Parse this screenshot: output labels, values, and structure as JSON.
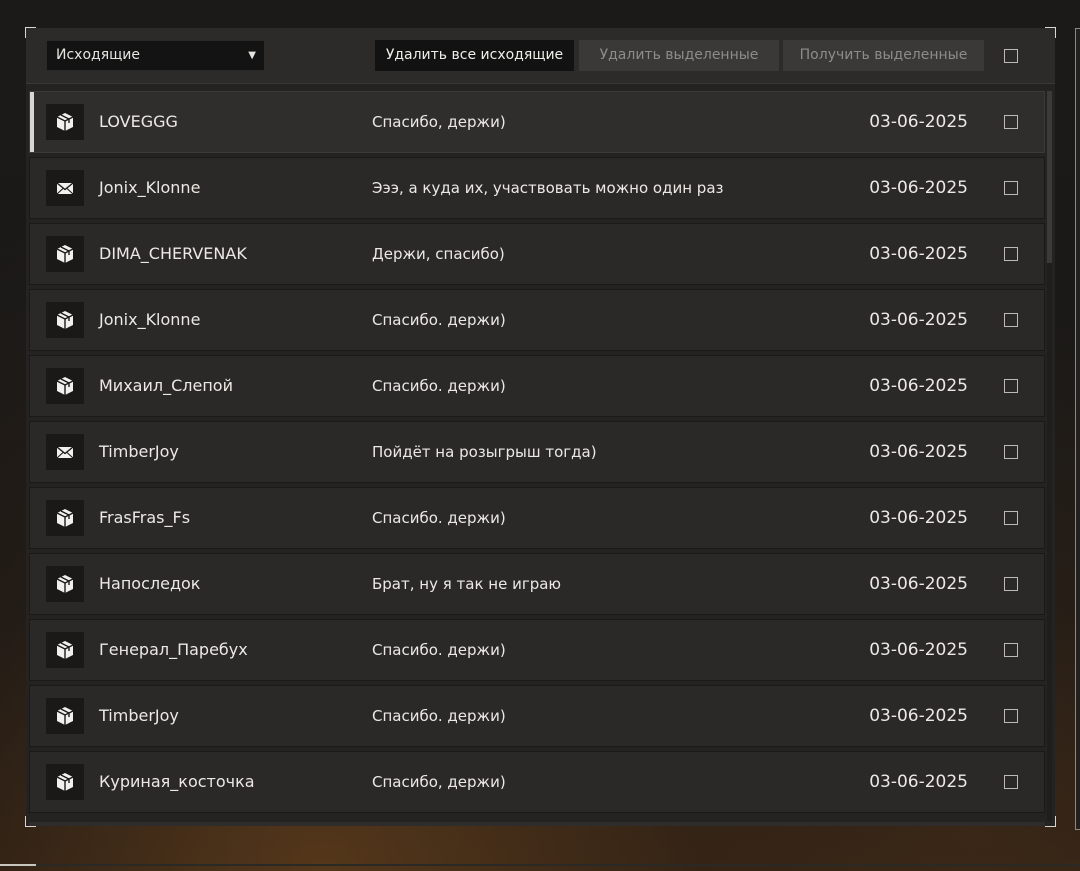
{
  "toolbar": {
    "folder_select": "Исходящие",
    "delete_all_label": "Удалить все исходящие",
    "delete_selected_label": "Удалить выделенные",
    "get_selected_label": "Получить выделенные"
  },
  "messages": [
    {
      "icon": "package-icon",
      "sender": "LOVEGGG",
      "text": "Спасибо, держи)",
      "date": "03-06-2025",
      "selected": false
    },
    {
      "icon": "envelope-icon",
      "sender": "Jonix_Klonne",
      "text": "Эээ, а куда их, участвовать можно один раз",
      "date": "03-06-2025",
      "selected": false
    },
    {
      "icon": "package-icon",
      "sender": "DIMA_CHERVENAK",
      "text": "Держи, спасибо)",
      "date": "03-06-2025",
      "selected": false
    },
    {
      "icon": "package-icon",
      "sender": "Jonix_Klonne",
      "text": "Спасибо. держи)",
      "date": "03-06-2025",
      "selected": false
    },
    {
      "icon": "package-icon",
      "sender": "Михаил_Слепой",
      "text": "Спасибо. держи)",
      "date": "03-06-2025",
      "selected": false
    },
    {
      "icon": "envelope-icon",
      "sender": "TimberJoy",
      "text": "Пойдёт на розыгрыш тогда)",
      "date": "03-06-2025",
      "selected": false
    },
    {
      "icon": "package-icon",
      "sender": "FrasFras_Fs",
      "text": "Спасибо. держи)",
      "date": "03-06-2025",
      "selected": false
    },
    {
      "icon": "package-icon",
      "sender": "Напоследок",
      "text": "Брат, ну я так не играю",
      "date": "03-06-2025",
      "selected": false
    },
    {
      "icon": "package-icon",
      "sender": "Генерал_Паребух",
      "text": "Спасибо. держи)",
      "date": "03-06-2025",
      "selected": false
    },
    {
      "icon": "package-icon",
      "sender": "TimberJoy",
      "text": "Спасибо. держи)",
      "date": "03-06-2025",
      "selected": false
    },
    {
      "icon": "package-icon",
      "sender": "Куриная_косточка",
      "text": "Спасибо, держи)",
      "date": "03-06-2025",
      "selected": false
    }
  ],
  "colors": {
    "panel": "#242322",
    "row": "#2a2928",
    "text": "#ece9e4",
    "disabled_text": "#8e8c88",
    "accent": "#d8d6d2"
  }
}
